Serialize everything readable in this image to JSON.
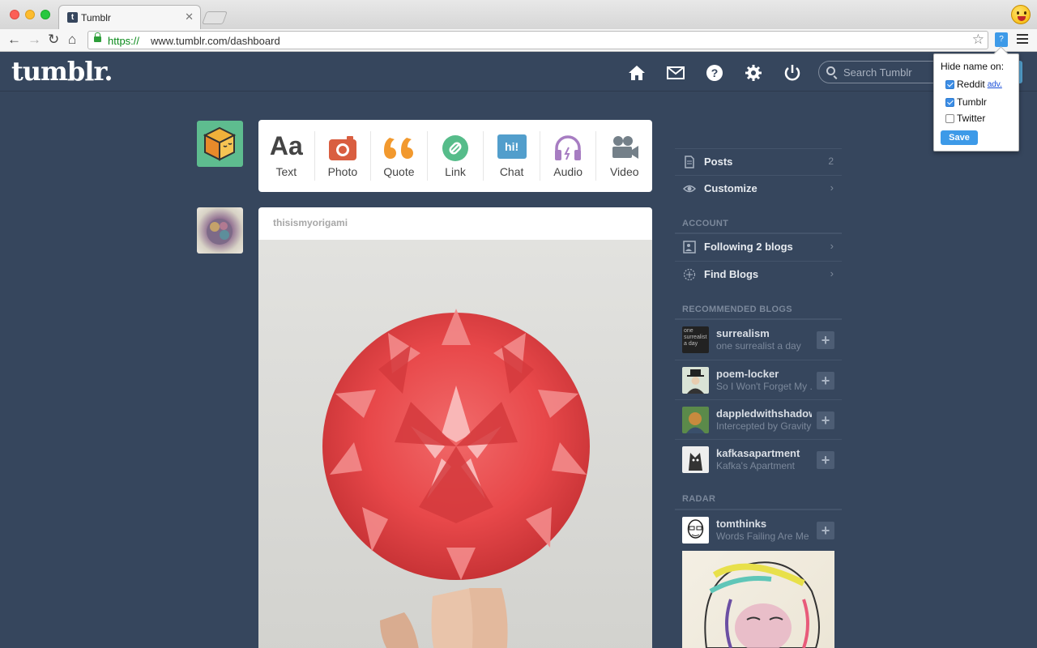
{
  "browser": {
    "tab_title": "Tumblr",
    "tab_favicon": "t",
    "url_scheme": "https://",
    "url_rest": "www.tumblr.com/dashboard",
    "ext_button": "?"
  },
  "header": {
    "logo": "tumblr.",
    "search_placeholder": "Search Tumblr",
    "icons": [
      "home-icon",
      "inbox-icon",
      "help-icon",
      "settings-icon",
      "logout-icon"
    ]
  },
  "composer": {
    "buttons": [
      {
        "label": "Text",
        "glyph": "Aa",
        "color": "#444444"
      },
      {
        "label": "Photo",
        "color": "#d95e40"
      },
      {
        "label": "Quote",
        "color": "#f2992e"
      },
      {
        "label": "Link",
        "color": "#56bc8a"
      },
      {
        "label": "Chat",
        "glyph": "hi!",
        "color": "#529ecc"
      },
      {
        "label": "Audio",
        "color": "#a77dc2"
      },
      {
        "label": "Video",
        "color": "#748089"
      }
    ]
  },
  "post": {
    "blog_name": "thisismyorigami"
  },
  "sidebar": {
    "posts_label": "Posts",
    "posts_count": "2",
    "customize_label": "Customize",
    "account_header": "ACCOUNT",
    "following_label": "Following 2 blogs",
    "find_blogs_label": "Find Blogs",
    "recommended_header": "RECOMMENDED BLOGS",
    "recommended": [
      {
        "name": "surrealism",
        "subtitle": "one surrealist a day",
        "avatar_text": "one surrealist a day"
      },
      {
        "name": "poem-locker",
        "subtitle": "So I Won't Forget My ..."
      },
      {
        "name": "dappledwithshadow",
        "subtitle": "Intercepted by Gravity"
      },
      {
        "name": "kafkasapartment",
        "subtitle": "Kafka's Apartment"
      }
    ],
    "radar_header": "RADAR",
    "radar": {
      "name": "tomthinks",
      "subtitle": "Words Failing Are Me"
    }
  },
  "extension_popup": {
    "title": "Hide name on:",
    "options": [
      {
        "label": "Reddit",
        "checked": true,
        "link": "adv."
      },
      {
        "label": "Tumblr",
        "checked": true
      },
      {
        "label": "Twitter",
        "checked": false
      }
    ],
    "save_label": "Save"
  },
  "colors": {
    "dashboard_bg": "#36465d",
    "accent_blue": "#529ecc",
    "url_green": "#0a8a1a"
  }
}
